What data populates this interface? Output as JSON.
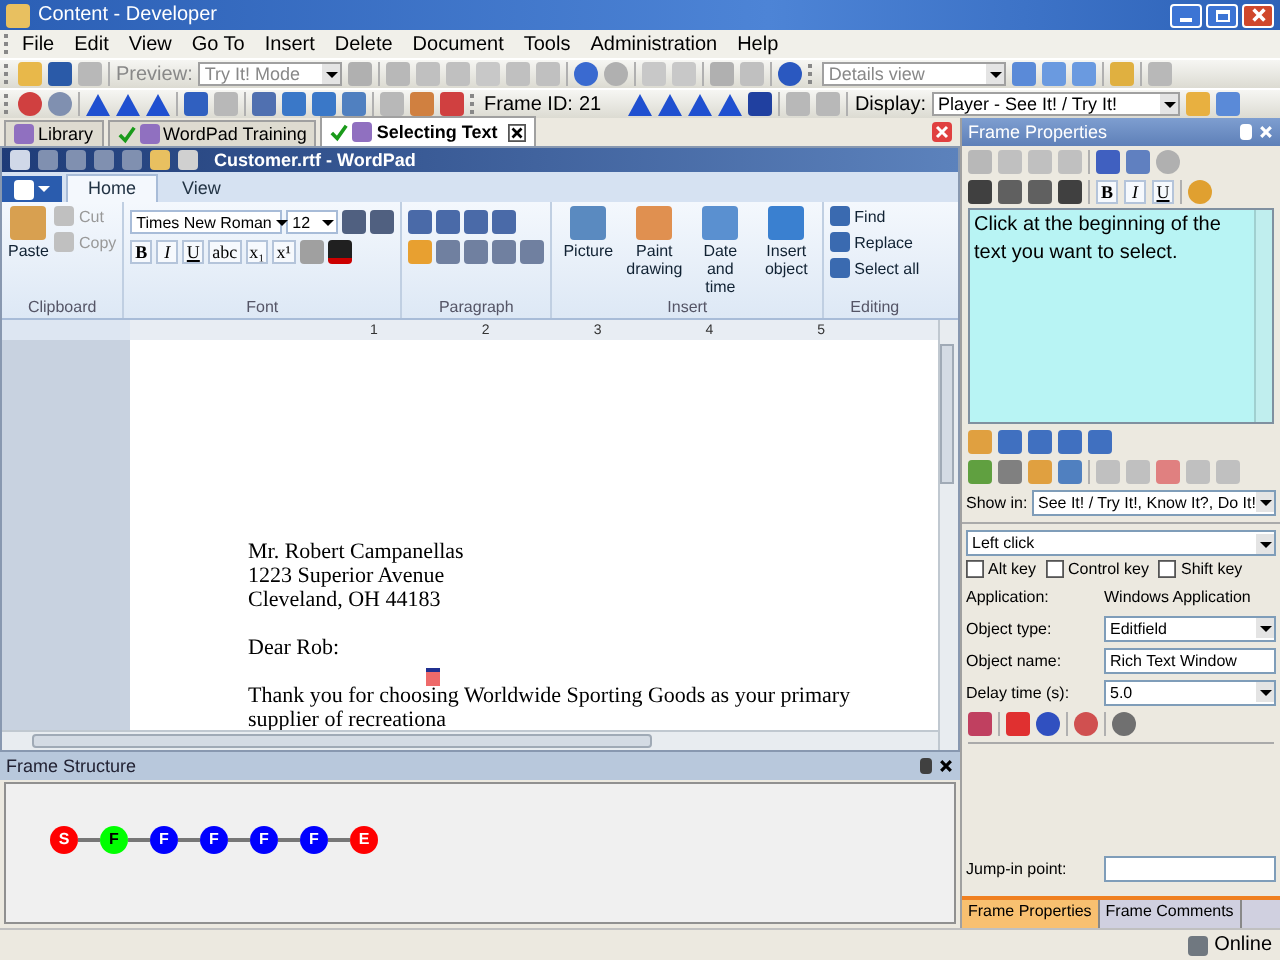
{
  "window": {
    "title": "Content - Developer"
  },
  "menu": [
    "File",
    "Edit",
    "View",
    "Go To",
    "Insert",
    "Delete",
    "Document",
    "Tools",
    "Administration",
    "Help"
  ],
  "toolbar": {
    "preview_label": "Preview:",
    "preview_mode": "Try It! Mode",
    "view_mode": "Details view"
  },
  "frame_bar": {
    "frame_id_label": "Frame ID:",
    "frame_id": "21",
    "display_label": "Display:",
    "display": "Player - See It! / Try It!"
  },
  "document_tabs": [
    {
      "label": "Library",
      "selected": false,
      "checked": false
    },
    {
      "label": "WordPad Training",
      "selected": false,
      "checked": true
    },
    {
      "label": "Selecting Text",
      "selected": true,
      "checked": true
    }
  ],
  "wordpad": {
    "title": "Customer.rtf - WordPad",
    "ribbon_tabs": [
      {
        "label": "Home",
        "selected": true
      },
      {
        "label": "View",
        "selected": false
      }
    ],
    "clipboard": {
      "paste": "Paste",
      "small": [
        {
          "label": "Cut",
          "disabled": true
        },
        {
          "label": "Copy",
          "disabled": true
        }
      ],
      "group": "Clipboard"
    },
    "font": {
      "family": "Times New Roman",
      "size": "12",
      "format_buttons": [
        "B",
        "I",
        "U",
        "abc",
        "x₁",
        "x¹"
      ],
      "group": "Font"
    },
    "paragraph": {
      "group": "Paragraph"
    },
    "insert": {
      "buttons": [
        "Picture",
        "Paint drawing",
        "Date and time",
        "Insert object"
      ],
      "group": "Insert"
    },
    "editing": {
      "buttons": [
        "Find",
        "Replace",
        "Select all"
      ],
      "group": "Editing"
    },
    "ruler": [
      "1",
      "2",
      "3",
      "4",
      "5"
    ],
    "paragraphs": [
      [
        "Mr. Robert Campanellas",
        "1223 Superior Avenue",
        "Cleveland, OH  44183"
      ],
      [
        "Dear Rob:"
      ],
      [
        "Thank you for choosing Worldwide Sporting Goods as your primary supplier of recreationa"
      ]
    ]
  },
  "frame_structure": {
    "title": "Frame Structure",
    "nodes": [
      {
        "label": "S",
        "color": "#ff0000"
      },
      {
        "label": "F",
        "color": "#00ff00"
      },
      {
        "label": "F",
        "color": "#0000ff"
      },
      {
        "label": "F",
        "color": "#0000ff"
      },
      {
        "label": "F",
        "color": "#0000ff"
      },
      {
        "label": "F",
        "color": "#0000ff"
      },
      {
        "label": "E",
        "color": "#ff0000"
      }
    ]
  },
  "frame_properties": {
    "title": "Frame Properties",
    "format_buttons": [
      "B",
      "I",
      "U"
    ],
    "instruction": "Click at the beginning of the text you want to select.",
    "show_in_label": "Show in:",
    "show_in": "See It! / Try It!, Know It?, Do It!",
    "action": "Left click",
    "modifiers": [
      {
        "label": "Alt key",
        "checked": false
      },
      {
        "label": "Control key",
        "checked": false
      },
      {
        "label": "Shift key",
        "checked": false
      }
    ],
    "application_label": "Application:",
    "application": "Windows Application",
    "fields": [
      {
        "label": "Object type:",
        "value": "Editfield",
        "kind": "dropdown"
      },
      {
        "label": "Object name:",
        "value": "Rich Text Window",
        "kind": "text"
      },
      {
        "label": "Delay time (s):",
        "value": "5.0",
        "kind": "dropdown"
      }
    ],
    "jump_in_label": "Jump-in point:"
  },
  "panel_tabs": [
    {
      "label": "Frame Properties",
      "selected": true
    },
    {
      "label": "Frame Comments",
      "selected": false
    }
  ],
  "status_bar": {
    "connection": "Online"
  }
}
